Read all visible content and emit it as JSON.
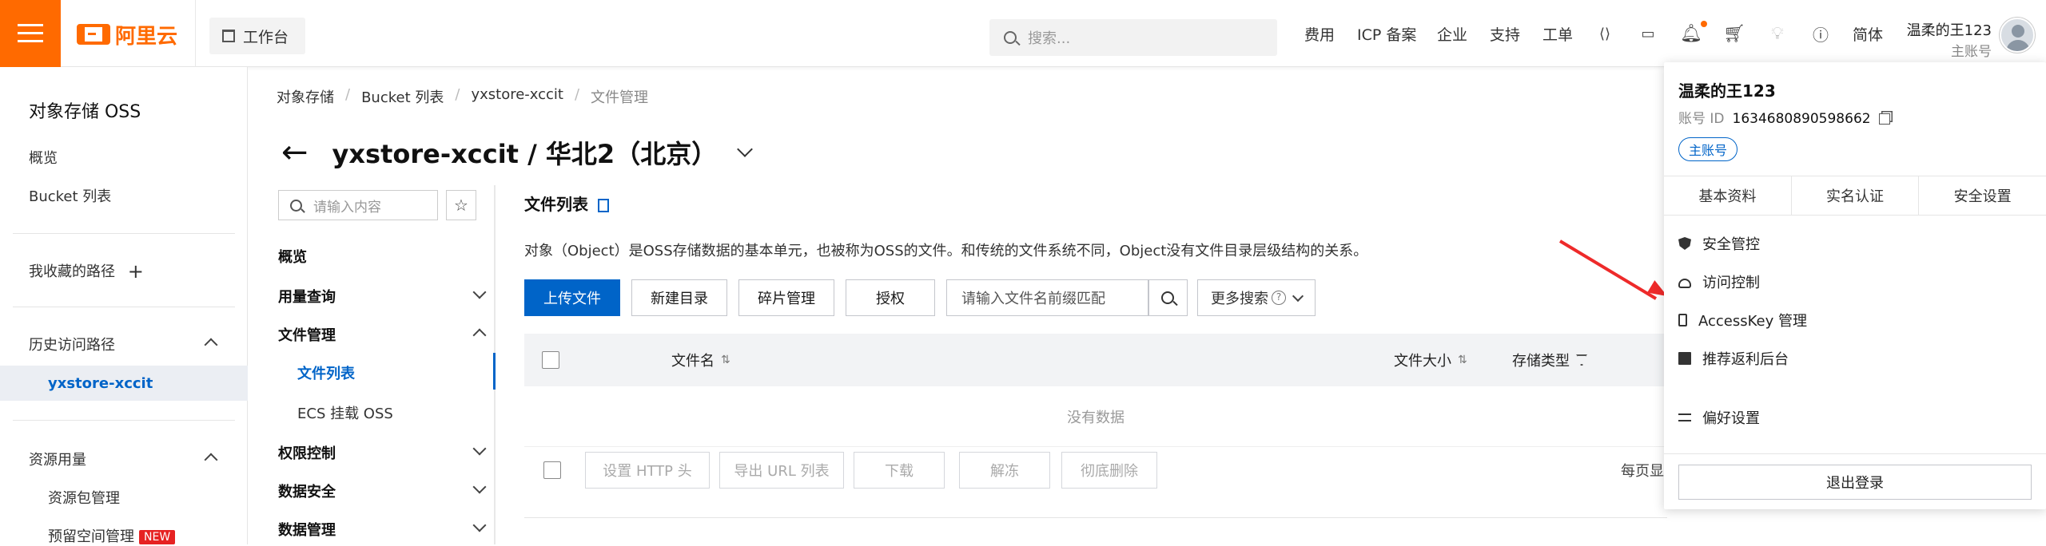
{
  "header": {
    "brand": "阿里云",
    "workbench": "工作台",
    "search_placeholder": "搜索...",
    "nav": [
      "费用",
      "ICP 备案",
      "企业",
      "支持",
      "工单"
    ],
    "lang": "简体",
    "user_name": "温柔的王123",
    "user_type": "主账号",
    "accent_color": "#ff6a00",
    "icons": [
      "code-icon",
      "terminal-icon",
      "bell-icon",
      "cart-icon",
      "bulb-icon",
      "help-icon"
    ]
  },
  "leftnav": {
    "title": "对象存储 OSS",
    "overview": "概览",
    "bucket_list": "Bucket 列表",
    "favorites": "我收藏的路径",
    "history": "历史访问路径",
    "history_item": "yxstore-xccit",
    "resources": "资源用量",
    "resource_pack": "资源包管理",
    "reserved_space": "预留空间管理",
    "new_badge": "NEW"
  },
  "breadcrumb": [
    "对象存储",
    "Bucket 列表",
    "yxstore-xccit",
    "文件管理"
  ],
  "page_title": "yxstore-xccit / 华北2（北京）",
  "subnav": {
    "search_placeholder": "请输入内容",
    "items": {
      "overview": "概览",
      "usage": "用量查询",
      "file_mgmt": "文件管理",
      "file_list": "文件列表",
      "ecs_mount": "ECS 挂载 OSS",
      "permission": "权限控制",
      "data_security": "数据安全",
      "data_mgmt": "数据管理"
    }
  },
  "main": {
    "section_title": "文件列表",
    "description": "对象（Object）是OSS存储数据的基本单元，也被称为OSS的文件。和传统的文件系统不同，Object没有文件目录层级结构的关系。",
    "buttons": {
      "upload": "上传文件",
      "new_dir": "新建目录",
      "fragments": "碎片管理",
      "authorize": "授权"
    },
    "file_search_placeholder": "请输入文件名前缀匹配",
    "more_search": "更多搜索",
    "columns": {
      "name": "文件名",
      "size": "文件大小",
      "storage": "存储类型"
    },
    "empty": "没有数据",
    "bottom_buttons": [
      "设置 HTTP 头",
      "导出 URL 列表",
      "下载",
      "解冻",
      "彻底删除"
    ],
    "page_size_label": "每页显"
  },
  "dropdown": {
    "name": "温柔的王123",
    "id_label": "账号 ID",
    "id_value": "1634680890598662",
    "badge": "主账号",
    "tabs": [
      "基本资料",
      "实名认证",
      "安全设置"
    ],
    "items": [
      "安全管控",
      "访问控制",
      "AccessKey 管理",
      "推荐返利后台"
    ],
    "preferences": "偏好设置",
    "logout": "退出登录"
  }
}
